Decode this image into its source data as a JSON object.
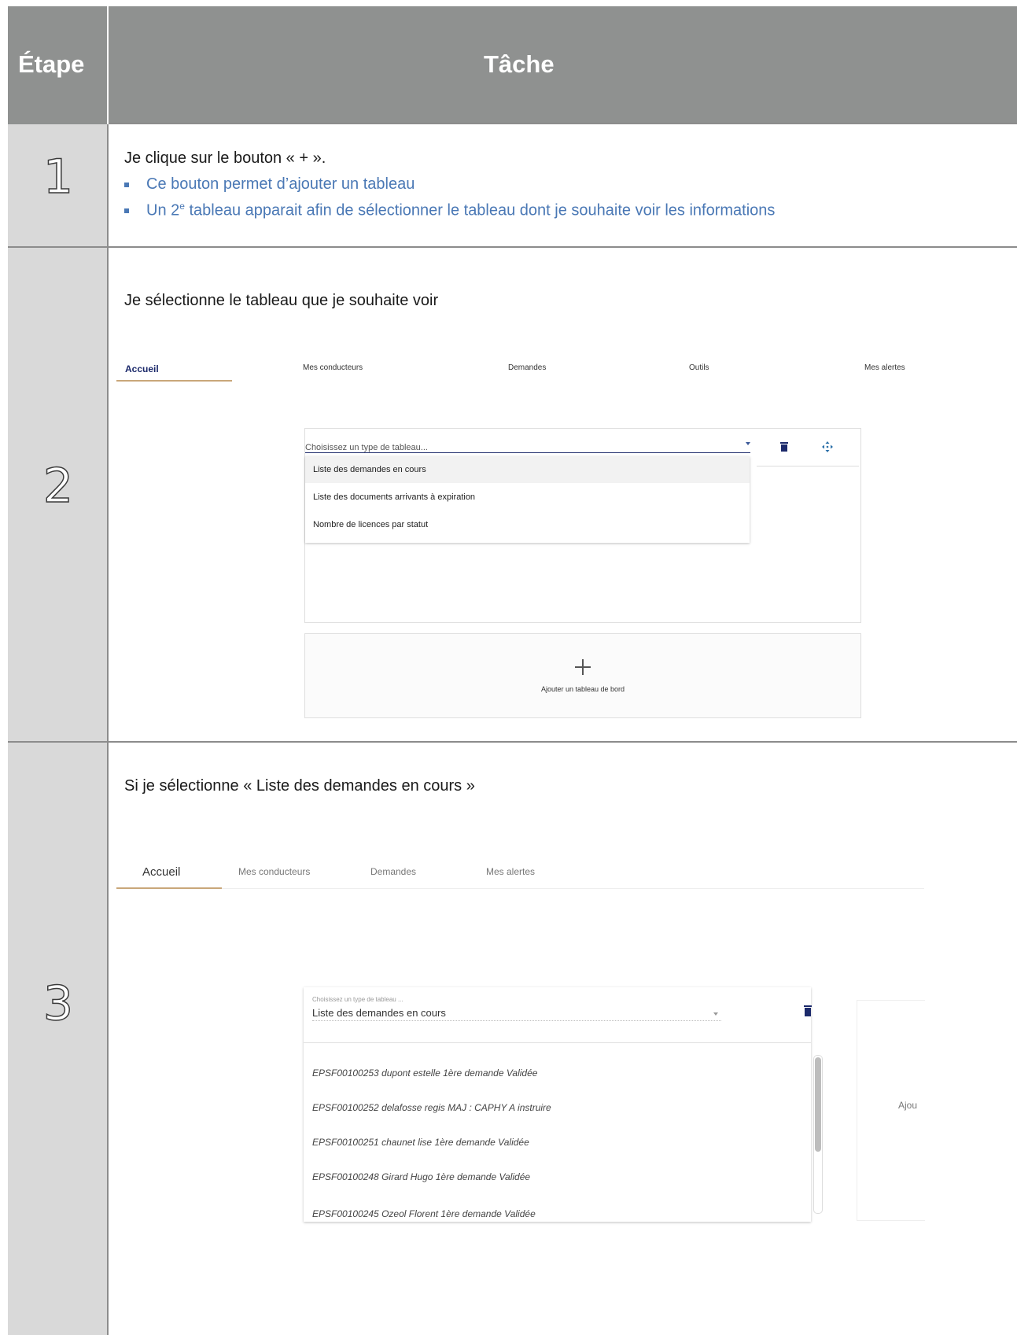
{
  "header": {
    "step_label": "Étape",
    "task_label": "Tâche"
  },
  "row1": {
    "step": "1",
    "instruction": "Je clique sur le bouton « + ».",
    "bullets": [
      "Ce bouton permet d’ajouter un tableau",
      "tableau apparait afin de sélectionner le tableau dont je souhaite voir les informations"
    ],
    "bullet2_prefix": "Un 2",
    "bullet2_sup": "e"
  },
  "row2": {
    "step": "2",
    "instruction": "Je sélectionne le tableau que je souhaite voir",
    "tabs": [
      "Accueil",
      "Mes conducteurs",
      "Demandes",
      "Outils",
      "Mes alertes"
    ],
    "select_placeholder": "Choisissez un type de tableau...",
    "options": [
      "Liste des demandes en cours",
      "Liste des documents arrivants à expiration",
      "Nombre de licences par statut"
    ],
    "add_label": "Ajouter un tableau de bord"
  },
  "row3": {
    "step": "3",
    "instruction": "Si je sélectionne « Liste des demandes en cours »",
    "tabs": [
      "Accueil",
      "Mes conducteurs",
      "Demandes",
      "Mes alertes"
    ],
    "select_caption": "Choisissez un type de tableau ...",
    "select_value": "Liste des demandes en cours",
    "items": [
      "EPSF00100253 dupont estelle 1ère demande Validée",
      "EPSF00100252 delafosse regis MAJ : CAPHY A instruire",
      "EPSF00100251 chaunet lise 1ère demande Validée",
      "EPSF00100248 Girard Hugo 1ère demande Validée",
      "EPSF00100245 Ozeol Florent 1ère demande Validée"
    ],
    "side_text": "Ajou"
  },
  "colors": {
    "header_bg": "#8f9190",
    "step_bg": "#d9d9d9",
    "accent_blue": "#4a78b5",
    "icon_navy": "#1c2a6b",
    "tab_underline": "#c9a77a"
  }
}
